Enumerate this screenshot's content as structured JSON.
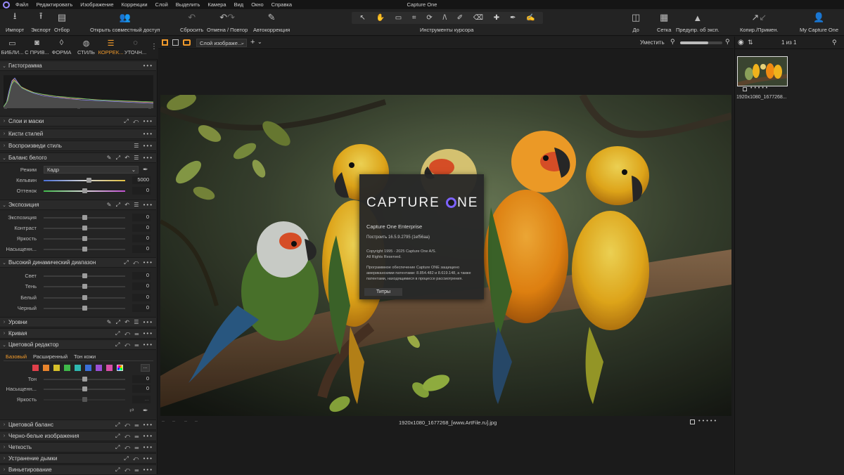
{
  "app_title": "Capture One",
  "menu": [
    "Файл",
    "Редактировать",
    "Изображение",
    "Коррекции",
    "Слой",
    "Выделить",
    "Камера",
    "Вид",
    "Окно",
    "Справка"
  ],
  "toolbar": {
    "import": "Импорт",
    "export": "Экспорт",
    "cull": "Отбор",
    "share": "Открыть совместный доступ",
    "reset": "Сбросить",
    "undo_redo": "Отмена / Повтор",
    "autoadjust": "Автокоррекция",
    "cursor_tools": "Инструменты курсора",
    "before": "До",
    "grid": "Сетка",
    "exposure_warning": "Предупр. об эксп.",
    "copy_apply": "Копир./Примен.",
    "account": "My Capture One"
  },
  "tool_tabs": [
    {
      "label": "БИБЛИ...",
      "icon": "folder-icon"
    },
    {
      "label": "С ПРИВ...",
      "icon": "camera-icon"
    },
    {
      "label": "ФОРМА",
      "icon": "shape-icon"
    },
    {
      "label": "СТИЛЬ",
      "icon": "style-icon"
    },
    {
      "label": "КОРРЕК...",
      "icon": "sliders-icon",
      "active": true
    },
    {
      "label": "УТОЧН...",
      "icon": "refine-icon"
    }
  ],
  "panels": {
    "histogram": "Гистограмма",
    "histogram_ticks": [
      "--",
      "--",
      "--"
    ],
    "layers": "Слои и маски",
    "style_brushes": "Кисти стилей",
    "reproduce_style": "Воспроизведи стиль",
    "white_balance": {
      "title": "Баланс белого",
      "mode_label": "Режим",
      "mode_value": "Кадр",
      "kelvin_label": "Кельвин",
      "kelvin_value": "5000",
      "tint_label": "Оттенок",
      "tint_value": "0"
    },
    "exposure": {
      "title": "Экспозиция",
      "rows": [
        {
          "label": "Экспозиция",
          "value": "0"
        },
        {
          "label": "Контраст",
          "value": "0"
        },
        {
          "label": "Яркость",
          "value": "0"
        },
        {
          "label": "Насыщенн...",
          "value": "0"
        }
      ]
    },
    "hdr": {
      "title": "Высокий динамический диапазон",
      "rows": [
        {
          "label": "Свет",
          "value": "0"
        },
        {
          "label": "Тень",
          "value": "0"
        },
        {
          "label": "Белый",
          "value": "0"
        },
        {
          "label": "Черный",
          "value": "0"
        }
      ]
    },
    "levels": "Уровни",
    "curve": "Кривая",
    "color_editor": {
      "title": "Цветовой редактор",
      "tabs": [
        "Базовый",
        "Расширенный",
        "Тон кожи"
      ],
      "swatches": [
        "#e0404a",
        "#e8842c",
        "#d6c02a",
        "#3fb84a",
        "#2eb8b0",
        "#3a6fd8",
        "#9a4fd6",
        "#d84fa8"
      ],
      "more": "...",
      "rows": [
        {
          "label": "Тон",
          "value": "0"
        },
        {
          "label": "Насыщенн...",
          "value": "0"
        },
        {
          "label": "Яркость",
          "value": "..."
        }
      ]
    },
    "color_balance": "Цветовой баланс",
    "bw": "Черно-белые изображения",
    "clarity": "Четкость",
    "dehaze": "Устранение дымки",
    "vignetting": "Виньетирование"
  },
  "viewer": {
    "layer_select": "Слой изображе...",
    "fit": "Уместить",
    "filename": "1920x1080_1677268_[www.ArtFile.ru].jpg",
    "footer_left": [
      "--",
      "--",
      "--",
      "--"
    ]
  },
  "splash": {
    "logo_a": "CAPTURE ",
    "logo_b": "NE",
    "edition": "Capture One Enterprise",
    "build": "Построить 16.5.9.2795 (1ef56aa)",
    "copyright1": "Copyright 1995 - 2025 Capture One A/S.",
    "copyright2": "All Rights Reserved.",
    "patents": "Программное обеспечение Capture ONE защищено американскими патентами: 8.854.482 и 8.619.148, а также патентами, находящимися в процессе рассмотрения.",
    "credits": "Титры"
  },
  "browser": {
    "count": "1 из 1",
    "thumb_name": "1920x1080_1677268..."
  },
  "colors": {
    "accent": "#f29b2c",
    "logo_ring": "#7d63ff"
  }
}
